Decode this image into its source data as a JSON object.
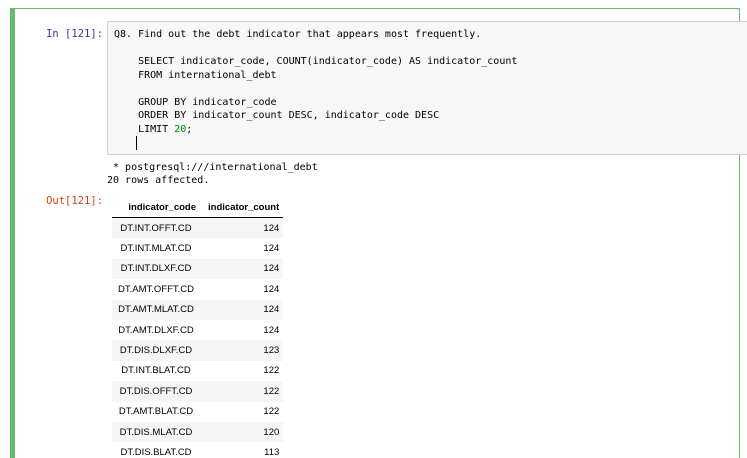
{
  "cell": {
    "in_prompt": "In [121]:",
    "out_prompt": "Out[121]:",
    "code_lines": {
      "l1": "Q8. Find out the debt indicator that appears most frequently.",
      "l2": "",
      "l3": "    SELECT indicator_code, COUNT(indicator_code) AS indicator_count",
      "l4": "    FROM international_debt",
      "l5": "",
      "l6": "    GROUP BY indicator_code",
      "l7": "    ORDER BY indicator_count DESC, indicator_code DESC",
      "l8_prefix": "    LIMIT ",
      "l8_number": "20",
      "l8_suffix": ";"
    },
    "stdout": {
      "connection": " * postgresql:///international_debt",
      "rows_affected": "20 rows affected."
    }
  },
  "table": {
    "headers": {
      "col1": "indicator_code",
      "col2": "indicator_count"
    },
    "rows": [
      {
        "indicator_code": "DT.INT.OFFT.CD",
        "indicator_count": "124"
      },
      {
        "indicator_code": "DT.INT.MLAT.CD",
        "indicator_count": "124"
      },
      {
        "indicator_code": "DT.INT.DLXF.CD",
        "indicator_count": "124"
      },
      {
        "indicator_code": "DT.AMT.OFFT.CD",
        "indicator_count": "124"
      },
      {
        "indicator_code": "DT.AMT.MLAT.CD",
        "indicator_count": "124"
      },
      {
        "indicator_code": "DT.AMT.DLXF.CD",
        "indicator_count": "124"
      },
      {
        "indicator_code": "DT.DIS.DLXF.CD",
        "indicator_count": "123"
      },
      {
        "indicator_code": "DT.INT.BLAT.CD",
        "indicator_count": "122"
      },
      {
        "indicator_code": "DT.DIS.OFFT.CD",
        "indicator_count": "122"
      },
      {
        "indicator_code": "DT.AMT.BLAT.CD",
        "indicator_count": "122"
      },
      {
        "indicator_code": "DT.DIS.MLAT.CD",
        "indicator_count": "120"
      },
      {
        "indicator_code": "DT.DIS.BLAT.CD",
        "indicator_count": "113"
      }
    ]
  },
  "colors": {
    "cell_border": "#66bb6a",
    "in_prompt": "#303f9f",
    "out_prompt": "#d84315",
    "number_literal": "#008800"
  }
}
